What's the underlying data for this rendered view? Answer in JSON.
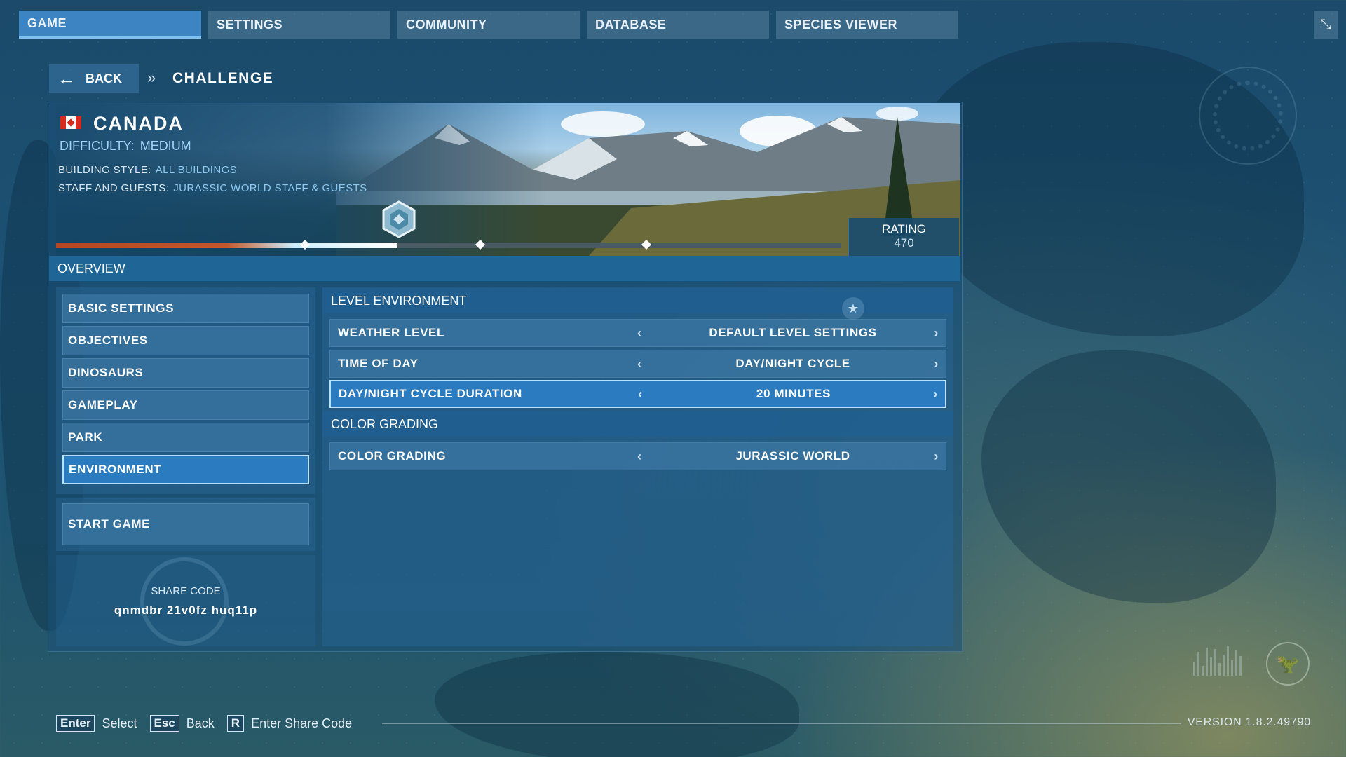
{
  "nav": {
    "tabs": [
      {
        "label": "GAME",
        "active": true
      },
      {
        "label": "SETTINGS",
        "active": false
      },
      {
        "label": "COMMUNITY",
        "active": false
      },
      {
        "label": "DATABASE",
        "active": false
      },
      {
        "label": "SPECIES VIEWER",
        "active": false
      }
    ],
    "close_icon": "close-icon"
  },
  "breadcrumb": {
    "back_label": "BACK",
    "separator": "»",
    "current": "CHALLENGE"
  },
  "level": {
    "country": "CANADA",
    "difficulty_label": "DIFFICULTY:",
    "difficulty_value": "MEDIUM",
    "building_style_label": "BUILDING STYLE:",
    "building_style_value": "ALL BUILDINGS",
    "staff_label": "STAFF AND GUESTS:",
    "staff_value": "JURASSIC WORLD STAFF & GUESTS",
    "rating_label": "RATING",
    "rating_value": "470",
    "progress_fraction": 0.435,
    "progress_markers": [
      0.317,
      0.54,
      0.752
    ]
  },
  "overview_label": "OVERVIEW",
  "menu": {
    "items": [
      {
        "label": "BASIC SETTINGS",
        "active": false
      },
      {
        "label": "OBJECTIVES",
        "active": false
      },
      {
        "label": "DINOSAURS",
        "active": false
      },
      {
        "label": "GAMEPLAY",
        "active": false
      },
      {
        "label": "PARK",
        "active": false
      },
      {
        "label": "ENVIRONMENT",
        "active": true
      }
    ],
    "start_game": "START GAME"
  },
  "share": {
    "label": "SHARE CODE",
    "code": "qnmdbr 21v0fz huq11p"
  },
  "environment": {
    "level_environment_header": "LEVEL ENVIRONMENT",
    "settings": [
      {
        "name": "WEATHER LEVEL",
        "value": "DEFAULT LEVEL SETTINGS",
        "active": false
      },
      {
        "name": "TIME OF DAY",
        "value": "DAY/NIGHT CYCLE",
        "active": false
      },
      {
        "name": "DAY/NIGHT CYCLE DURATION",
        "value": "20 MINUTES",
        "active": true
      }
    ],
    "color_grading_header": "COLOR GRADING",
    "color_settings": [
      {
        "name": "COLOR GRADING",
        "value": "JURASSIC WORLD",
        "active": false
      }
    ]
  },
  "footer": {
    "hints": [
      {
        "key": "Enter",
        "action": "Select"
      },
      {
        "key": "Esc",
        "action": "Back"
      },
      {
        "key": "R",
        "action": "Enter Share Code"
      }
    ],
    "version": "VERSION 1.8.2.49790"
  },
  "colors": {
    "accent": "#3d84c2",
    "active_border": "#b8e0ff",
    "progress_start": "#b5461f",
    "progress_end": "#ffffff"
  }
}
